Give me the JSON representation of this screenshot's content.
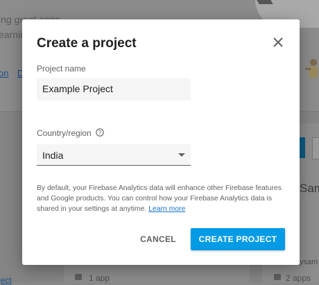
{
  "background": {
    "line1": "ing great apps",
    "line2": "earning",
    "link1": "on",
    "link2": "D",
    "card_title_partial": "Sam",
    "card_sub_partial": "ysam",
    "app_count_left": "1 app",
    "app_count_right": "2 apps",
    "project_link_partial": "ject"
  },
  "dialog": {
    "title": "Create a project",
    "project_name_label": "Project name",
    "project_name_value": "Example Project",
    "country_label": "Country/region",
    "country_value": "India",
    "description": "By default, your Firebase Analytics data will enhance other Firebase features and Google products. You can control how your Firebase Analytics data is shared in your settings at anytime.",
    "learn_more": "Learn more",
    "cancel_label": "CANCEL",
    "create_label": "CREATE PROJECT"
  },
  "icons": {
    "close": "close-icon",
    "help": "help-circle-icon",
    "dropdown": "dropdown-arrow-icon"
  },
  "colors": {
    "accent": "#039be5",
    "link": "#1a73c8"
  }
}
